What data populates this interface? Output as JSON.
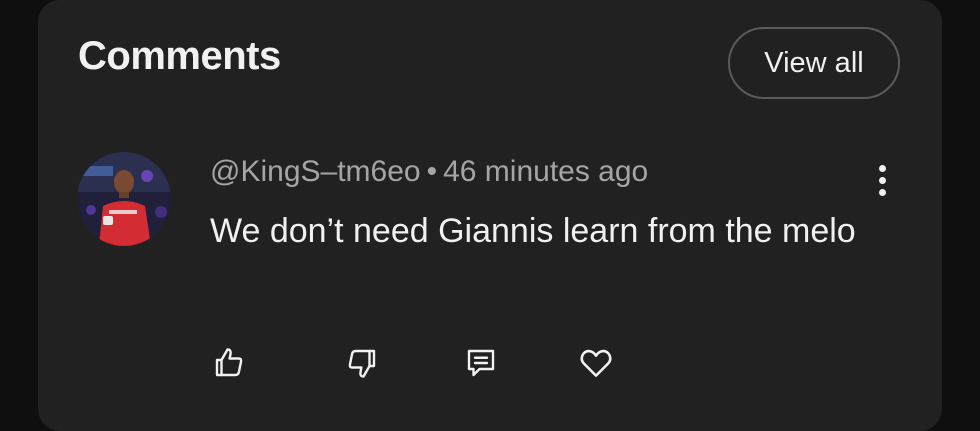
{
  "section": {
    "title": "Comments",
    "view_all_label": "View all"
  },
  "comment": {
    "author": "@KingS–tm6eo",
    "separator": "•",
    "time_ago": "46 minutes ago",
    "text": "We don’t need Giannis learn from the melo"
  },
  "actions": {
    "like_icon": "thumbs-up-icon",
    "dislike_icon": "thumbs-down-icon",
    "reply_icon": "reply-icon",
    "heart_icon": "heart-icon",
    "more_icon": "more-vertical-icon"
  },
  "colors": {
    "background": "#0f0f0f",
    "card": "#212121",
    "text_primary": "#f1f1f1",
    "text_secondary": "#a5a5a5"
  }
}
